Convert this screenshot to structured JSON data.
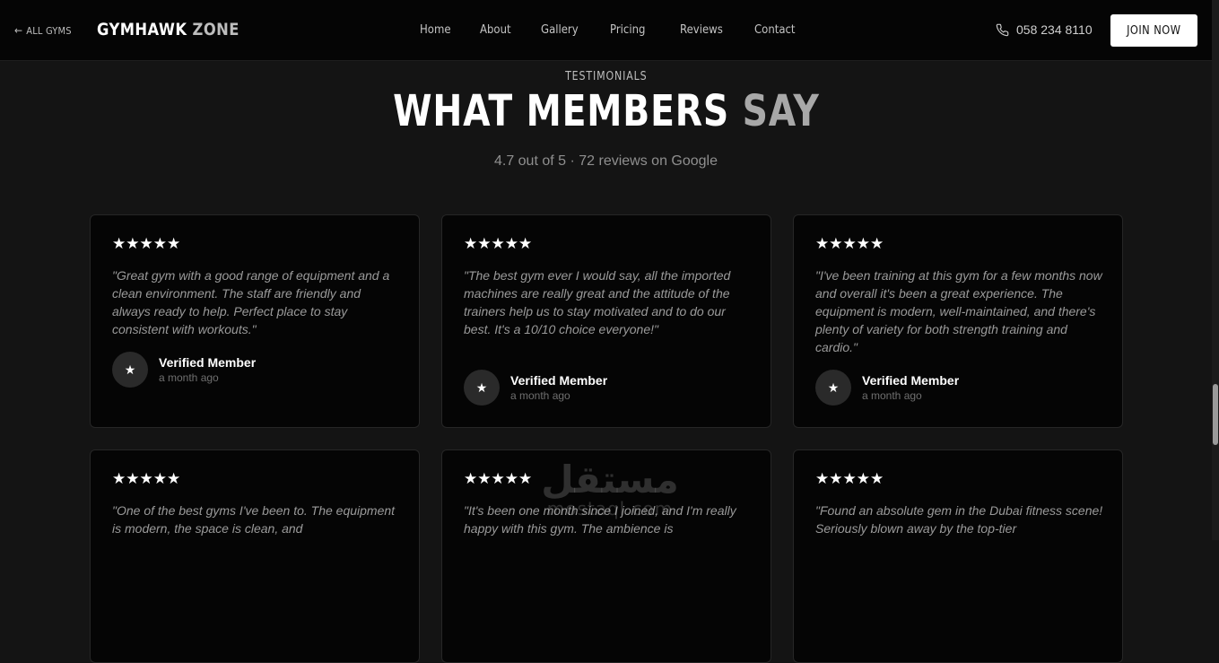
{
  "header": {
    "back_label": "ALL GYMS",
    "back_icon": "arrow-left-icon",
    "logo_primary": "GYMHAWK",
    "logo_secondary": "ZONE",
    "nav": [
      "Home",
      "About",
      "Gallery",
      "Pricing",
      "Reviews",
      "Contact"
    ],
    "phone": "058 234 8110",
    "phone_icon": "phone-icon",
    "cta": "JOIN NOW"
  },
  "section": {
    "eyebrow": "TESTIMONIALS",
    "title_primary": "WHAT MEMBERS",
    "title_secondary": "SAY",
    "rating_text": "4.7 out of 5 · 72 reviews on Google"
  },
  "reviews": [
    {
      "stars": 5,
      "quote": "\"Great gym with a good range of equipment and a clean environment. The staff are friendly and always ready to help. Perfect place to stay consistent with workouts.\"",
      "author": "Verified Member",
      "time": "a month ago"
    },
    {
      "stars": 5,
      "quote": "\"The best gym ever I would say, all the imported machines are really great and the attitude of the trainers help us to stay motivated and to do our best. It's a 10/10 choice everyone!\"",
      "author": "Verified Member",
      "time": "a month ago"
    },
    {
      "stars": 5,
      "quote": "\"I've been training at this gym for a few months now and overall it's been a great experience. The equipment is modern, well-maintained, and there's plenty of variety for both strength training and cardio.\"",
      "author": "Verified Member",
      "time": "a month ago"
    },
    {
      "stars": 5,
      "quote": "\"One of the best gyms I've been to. The equipment is modern, the space is clean, and",
      "author": "",
      "time": ""
    },
    {
      "stars": 5,
      "quote": "\"It's been one month since I joined, and I'm really happy with this gym. The ambience is",
      "author": "",
      "time": ""
    },
    {
      "stars": 5,
      "quote": "\"Found an absolute gem in the Dubai fitness scene! Seriously blown away by the top-tier",
      "author": "",
      "time": ""
    }
  ],
  "star_glyph": "★★★★★",
  "avatar_glyph": "★",
  "watermark": {
    "arabic": "مستقل",
    "latin": "mostaql.com"
  },
  "colors": {
    "background": "#141414",
    "header": "#050505",
    "card": "#050505",
    "accent_text": "#a8a8a8"
  }
}
